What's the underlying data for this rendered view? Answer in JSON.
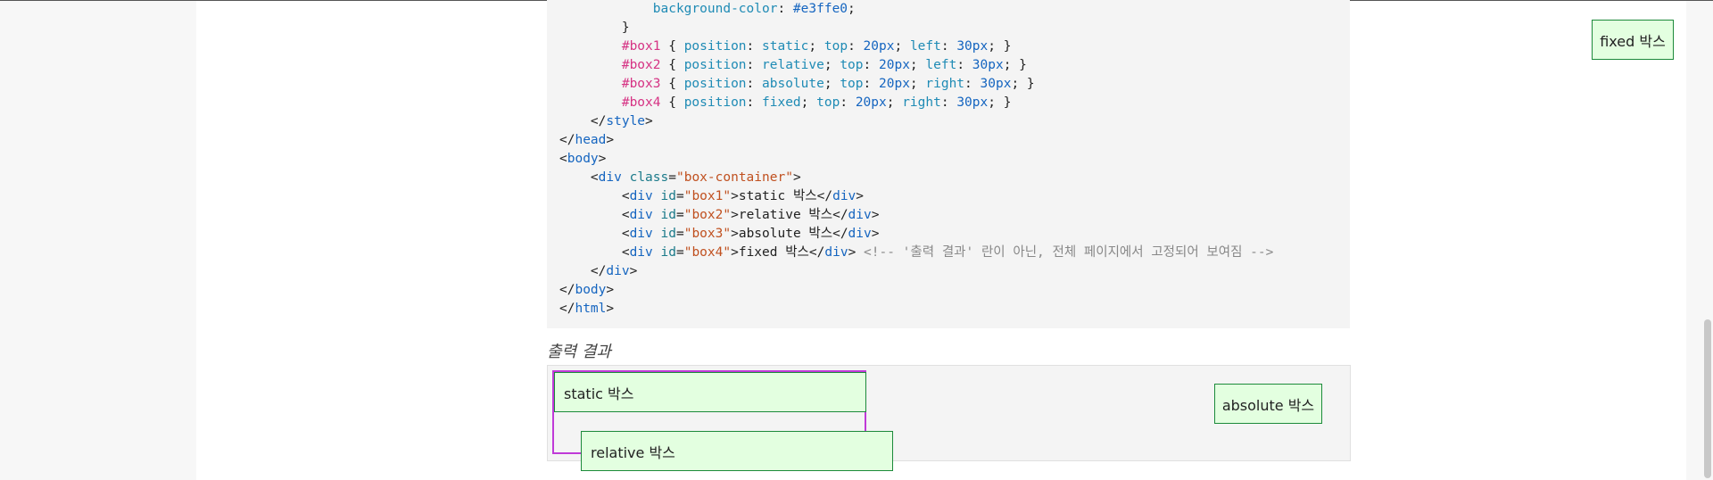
{
  "code_lines": [
    {
      "indent": "            ",
      "parts": [
        {
          "t": "prop",
          "v": "background-color"
        },
        {
          "t": "punc",
          "v": ": "
        },
        {
          "t": "num",
          "v": "#e3ffe0"
        },
        {
          "t": "punc",
          "v": ";"
        }
      ]
    },
    {
      "indent": "        ",
      "parts": [
        {
          "t": "punc",
          "v": "}"
        }
      ]
    },
    {
      "indent": "        ",
      "parts": [
        {
          "t": "sel",
          "v": "#box1"
        },
        {
          "t": "punc",
          "v": " { "
        },
        {
          "t": "prop",
          "v": "position"
        },
        {
          "t": "punc",
          "v": ": "
        },
        {
          "t": "prop",
          "v": "static"
        },
        {
          "t": "punc",
          "v": "; "
        },
        {
          "t": "prop",
          "v": "top"
        },
        {
          "t": "punc",
          "v": ": "
        },
        {
          "t": "num",
          "v": "20px"
        },
        {
          "t": "punc",
          "v": "; "
        },
        {
          "t": "prop",
          "v": "left"
        },
        {
          "t": "punc",
          "v": ": "
        },
        {
          "t": "num",
          "v": "30px"
        },
        {
          "t": "punc",
          "v": "; }"
        }
      ]
    },
    {
      "indent": "        ",
      "parts": [
        {
          "t": "sel",
          "v": "#box2"
        },
        {
          "t": "punc",
          "v": " { "
        },
        {
          "t": "prop",
          "v": "position"
        },
        {
          "t": "punc",
          "v": ": "
        },
        {
          "t": "prop",
          "v": "relative"
        },
        {
          "t": "punc",
          "v": "; "
        },
        {
          "t": "prop",
          "v": "top"
        },
        {
          "t": "punc",
          "v": ": "
        },
        {
          "t": "num",
          "v": "20px"
        },
        {
          "t": "punc",
          "v": "; "
        },
        {
          "t": "prop",
          "v": "left"
        },
        {
          "t": "punc",
          "v": ": "
        },
        {
          "t": "num",
          "v": "30px"
        },
        {
          "t": "punc",
          "v": "; }"
        }
      ]
    },
    {
      "indent": "        ",
      "parts": [
        {
          "t": "sel",
          "v": "#box3"
        },
        {
          "t": "punc",
          "v": " { "
        },
        {
          "t": "prop",
          "v": "position"
        },
        {
          "t": "punc",
          "v": ": "
        },
        {
          "t": "prop",
          "v": "absolute"
        },
        {
          "t": "punc",
          "v": "; "
        },
        {
          "t": "prop",
          "v": "top"
        },
        {
          "t": "punc",
          "v": ": "
        },
        {
          "t": "num",
          "v": "20px"
        },
        {
          "t": "punc",
          "v": "; "
        },
        {
          "t": "prop",
          "v": "right"
        },
        {
          "t": "punc",
          "v": ": "
        },
        {
          "t": "num",
          "v": "30px"
        },
        {
          "t": "punc",
          "v": "; }"
        }
      ]
    },
    {
      "indent": "        ",
      "parts": [
        {
          "t": "sel",
          "v": "#box4"
        },
        {
          "t": "punc",
          "v": " { "
        },
        {
          "t": "prop",
          "v": "position"
        },
        {
          "t": "punc",
          "v": ": "
        },
        {
          "t": "prop",
          "v": "fixed"
        },
        {
          "t": "punc",
          "v": "; "
        },
        {
          "t": "prop",
          "v": "top"
        },
        {
          "t": "punc",
          "v": ": "
        },
        {
          "t": "num",
          "v": "20px"
        },
        {
          "t": "punc",
          "v": "; "
        },
        {
          "t": "prop",
          "v": "right"
        },
        {
          "t": "punc",
          "v": ": "
        },
        {
          "t": "num",
          "v": "30px"
        },
        {
          "t": "punc",
          "v": "; }"
        }
      ]
    },
    {
      "indent": "    ",
      "parts": [
        {
          "t": "punc",
          "v": "</"
        },
        {
          "t": "kw",
          "v": "style"
        },
        {
          "t": "punc",
          "v": ">"
        }
      ]
    },
    {
      "indent": "",
      "parts": [
        {
          "t": "punc",
          "v": "</"
        },
        {
          "t": "kw",
          "v": "head"
        },
        {
          "t": "punc",
          "v": ">"
        }
      ]
    },
    {
      "indent": "",
      "parts": [
        {
          "t": "punc",
          "v": "<"
        },
        {
          "t": "kw",
          "v": "body"
        },
        {
          "t": "punc",
          "v": ">"
        }
      ]
    },
    {
      "indent": "    ",
      "parts": [
        {
          "t": "punc",
          "v": "<"
        },
        {
          "t": "kw",
          "v": "div"
        },
        {
          "t": "punc",
          "v": " "
        },
        {
          "t": "attr",
          "v": "class"
        },
        {
          "t": "punc",
          "v": "="
        },
        {
          "t": "str",
          "v": "\"box-container\""
        },
        {
          "t": "punc",
          "v": ">"
        }
      ]
    },
    {
      "indent": "        ",
      "parts": [
        {
          "t": "punc",
          "v": "<"
        },
        {
          "t": "kw",
          "v": "div"
        },
        {
          "t": "punc",
          "v": " "
        },
        {
          "t": "attr",
          "v": "id"
        },
        {
          "t": "punc",
          "v": "="
        },
        {
          "t": "str",
          "v": "\"box1\""
        },
        {
          "t": "punc",
          "v": ">static 박스</"
        },
        {
          "t": "kw",
          "v": "div"
        },
        {
          "t": "punc",
          "v": ">"
        }
      ]
    },
    {
      "indent": "        ",
      "parts": [
        {
          "t": "punc",
          "v": "<"
        },
        {
          "t": "kw",
          "v": "div"
        },
        {
          "t": "punc",
          "v": " "
        },
        {
          "t": "attr",
          "v": "id"
        },
        {
          "t": "punc",
          "v": "="
        },
        {
          "t": "str",
          "v": "\"box2\""
        },
        {
          "t": "punc",
          "v": ">relative 박스</"
        },
        {
          "t": "kw",
          "v": "div"
        },
        {
          "t": "punc",
          "v": ">"
        }
      ]
    },
    {
      "indent": "        ",
      "parts": [
        {
          "t": "punc",
          "v": "<"
        },
        {
          "t": "kw",
          "v": "div"
        },
        {
          "t": "punc",
          "v": " "
        },
        {
          "t": "attr",
          "v": "id"
        },
        {
          "t": "punc",
          "v": "="
        },
        {
          "t": "str",
          "v": "\"box3\""
        },
        {
          "t": "punc",
          "v": ">absolute 박스</"
        },
        {
          "t": "kw",
          "v": "div"
        },
        {
          "t": "punc",
          "v": ">"
        }
      ]
    },
    {
      "indent": "        ",
      "parts": [
        {
          "t": "punc",
          "v": "<"
        },
        {
          "t": "kw",
          "v": "div"
        },
        {
          "t": "punc",
          "v": " "
        },
        {
          "t": "attr",
          "v": "id"
        },
        {
          "t": "punc",
          "v": "="
        },
        {
          "t": "str",
          "v": "\"box4\""
        },
        {
          "t": "punc",
          "v": ">fixed 박스</"
        },
        {
          "t": "kw",
          "v": "div"
        },
        {
          "t": "punc",
          "v": "> "
        },
        {
          "t": "cmt",
          "v": "<!-- '출력 결과' 란이 아닌, 전체 페이지에서 고정되어 보여짐 -->"
        }
      ]
    },
    {
      "indent": "    ",
      "parts": [
        {
          "t": "punc",
          "v": "</"
        },
        {
          "t": "kw",
          "v": "div"
        },
        {
          "t": "punc",
          "v": ">"
        }
      ]
    },
    {
      "indent": "",
      "parts": [
        {
          "t": "punc",
          "v": "</"
        },
        {
          "t": "kw",
          "v": "body"
        },
        {
          "t": "punc",
          "v": ">"
        }
      ]
    },
    {
      "indent": "",
      "parts": [
        {
          "t": "punc",
          "v": "</"
        },
        {
          "t": "kw",
          "v": "html"
        },
        {
          "t": "punc",
          "v": ">"
        }
      ]
    }
  ],
  "output": {
    "caption": "출력 결과",
    "box1_label": "static 박스",
    "box2_label": "relative 박스",
    "box3_label": "absolute 박스",
    "box4_label": "fixed 박스"
  },
  "colors": {
    "box_bg": "#e3ffe0",
    "box_border": "#1c8a3a",
    "container_border": "#c03ad8",
    "selector": "#d63384",
    "keyword": "#1565c0"
  }
}
